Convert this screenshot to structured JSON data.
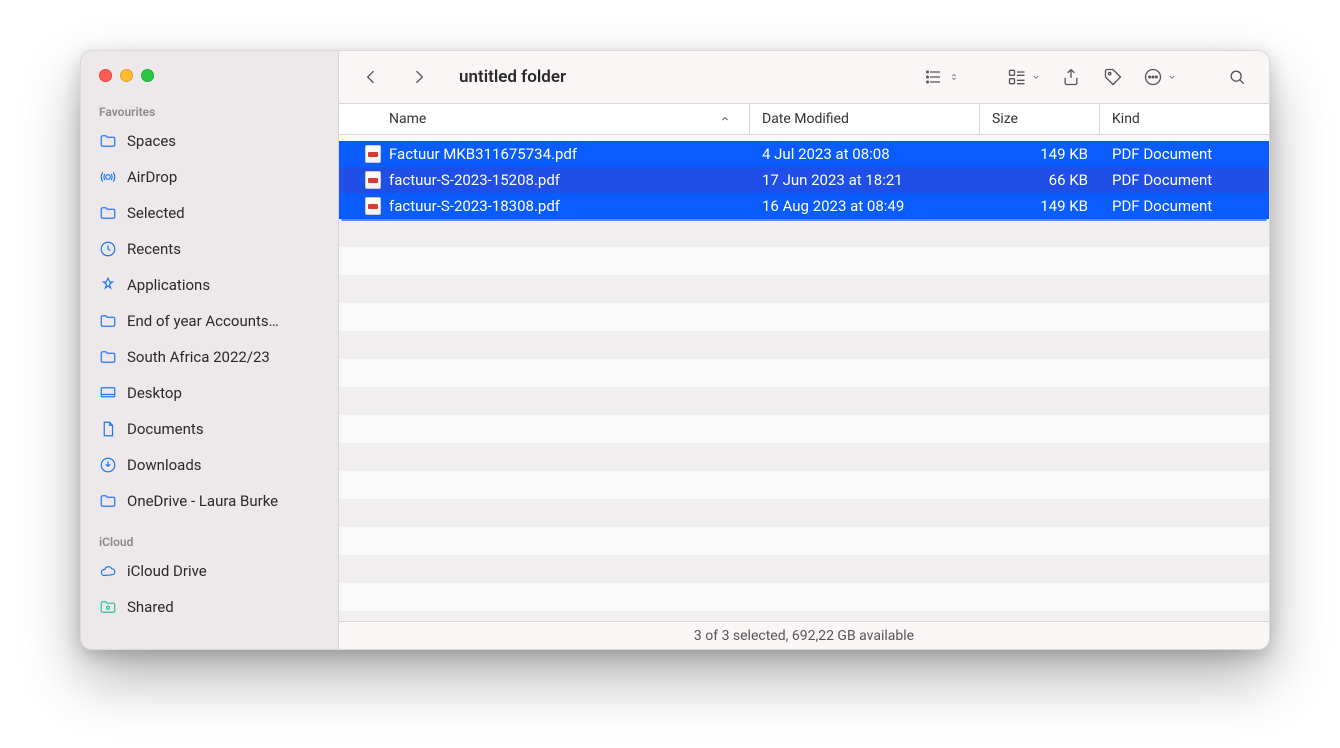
{
  "window": {
    "title": "untitled folder"
  },
  "sidebar": {
    "sections": [
      {
        "label": "Favourites",
        "items": [
          {
            "icon": "folder",
            "label": "Spaces"
          },
          {
            "icon": "airdrop",
            "label": "AirDrop"
          },
          {
            "icon": "folder",
            "label": "Selected"
          },
          {
            "icon": "clock",
            "label": "Recents"
          },
          {
            "icon": "apps",
            "label": "Applications"
          },
          {
            "icon": "folder",
            "label": "End of year Accounts…"
          },
          {
            "icon": "folder",
            "label": "South Africa 2022/23"
          },
          {
            "icon": "desktop",
            "label": "Desktop"
          },
          {
            "icon": "doc",
            "label": "Documents"
          },
          {
            "icon": "download",
            "label": "Downloads"
          },
          {
            "icon": "folder",
            "label": "OneDrive - Laura Burke"
          }
        ]
      },
      {
        "label": "iCloud",
        "items": [
          {
            "icon": "cloud",
            "label": "iCloud Drive"
          },
          {
            "icon": "shared",
            "label": "Shared"
          }
        ]
      }
    ]
  },
  "columns": {
    "name": "Name",
    "date": "Date Modified",
    "size": "Size",
    "kind": "Kind"
  },
  "files": [
    {
      "name": "Factuur MKB311675734.pdf",
      "date": "4 Jul 2023 at 08:08",
      "size": "149 KB",
      "kind": "PDF Document"
    },
    {
      "name": "factuur-S-2023-15208.pdf",
      "date": "17 Jun 2023 at 18:21",
      "size": "66 KB",
      "kind": "PDF Document"
    },
    {
      "name": "factuur-S-2023-18308.pdf",
      "date": "16 Aug 2023 at 08:49",
      "size": "149 KB",
      "kind": "PDF Document"
    }
  ],
  "status": "3 of 3 selected, 692,22 GB available"
}
